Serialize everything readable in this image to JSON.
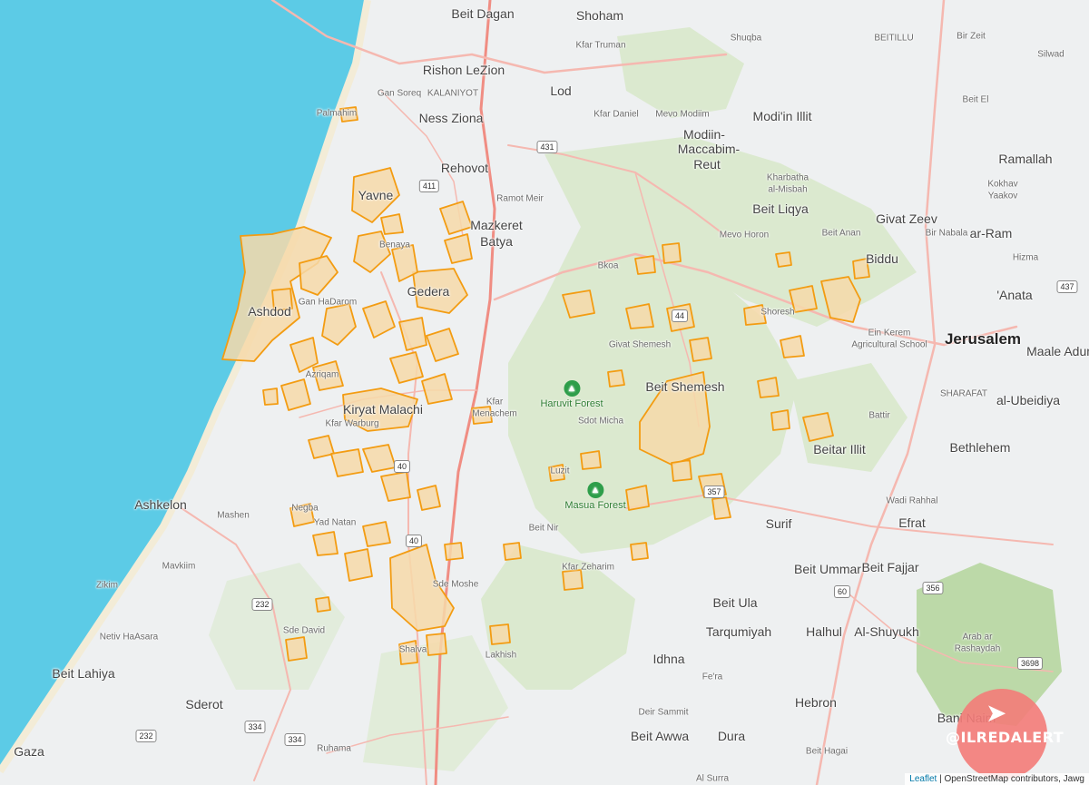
{
  "colors": {
    "sea": "#5ccbe6",
    "land": "#eef0f1",
    "woodland": "#dbe9cf",
    "alert_fill": "#f6d9a9",
    "alert_stroke": "#f39c12",
    "road": "#f5b8b0",
    "highway": "#f08d83"
  },
  "labels": {
    "beit_dagan": "Beit Dagan",
    "shoham": "Shoham",
    "kfar_truman": "Kfar Truman",
    "shuqba": "Shuqba",
    "beitillu": "BEITILLU",
    "bir_zeit": "Bir Zeit",
    "silwad": "Silwad",
    "rishon": "Rishon LeZion",
    "kalaniyot": "KALANIYOT",
    "gan_soreq": "Gan Soreq",
    "lod": "Lod",
    "palmahim": "Palmahim",
    "ness_ziona": "Ness Ziona",
    "kfar_daniel": "Kfar Daniel",
    "mevo_modiim": "Mevo Modiim",
    "modiin_illit": "Modi'in Illit",
    "beit_el": "Beit El",
    "modiin": "Modiin-",
    "maccabim": "Maccabim-",
    "reut": "Reut",
    "ramallah": "Ramallah",
    "rehovot": "Rehovot",
    "kharbatha": "Kharbatha",
    "al_misbah": "al-Misbah",
    "kokhav": "Kokhav",
    "yaakov": "Yaakov",
    "yavne": "Yavne",
    "ramot_meir": "Ramot Meir",
    "mazkeret": "Mazkeret",
    "batya": "Batya",
    "beit_liqya": "Beit Liqya",
    "givat_zeev": "Givat Zeev",
    "beit_anan": "Beit Anan",
    "biddu": "Biddu",
    "mevo_horon": "Mevo Horon",
    "bir_nabala": "Bir Nabala",
    "ar_ram": "ar-Ram",
    "benaya": "Benaya",
    "hizma": "Hizma",
    "bkoa": "Bkoa",
    "gedera": "Gedera",
    "gan_haharom": "Gan HaDarom",
    "ashdod": "Ashdod",
    "anata": "'Anata",
    "shoresh": "Shoresh",
    "ein_kerem": "Ein Kerem",
    "agri_school": "Agricultural School",
    "jerusalem": "Jerusalem",
    "maale_adumim": "Maale Adum",
    "givat_shemesh": "Givat Shemesh",
    "azriqam": "Azriqam",
    "beit_shemesh": "Beit Shemesh",
    "sharafat": "SHARAFAT",
    "kiryat_malachi": "Kiryat Malachi",
    "kfar_menachem_1": "Kfar",
    "kfar_menachem_2": "Menachem",
    "sdot_micha": "Sdot Micha",
    "battir": "Battir",
    "al_ubeidiya": "al-Ubeidiya",
    "kfar_warburg": "Kfar Warburg",
    "beitar_illit": "Beitar Illit",
    "bethlehem": "Bethlehem",
    "luzit": "Luzit",
    "ashkelon": "Ashkelon",
    "wadi_rahhal": "Wadi Rahhal",
    "negba": "Negba",
    "yad_natan": "Yad Natan",
    "efrat": "Efrat",
    "mashen": "Mashen",
    "beit_nir": "Beit Nir",
    "surif": "Surif",
    "mavkiim": "Mavkiim",
    "kfar_zeharim": "Kfar Zeharim",
    "beit_ummar": "Beit Ummar",
    "beit_fajjar": "Beit Fajjar",
    "sde_moshe": "Sde Moshe",
    "zikim": "Zikim",
    "beit_ula": "Beit Ula",
    "sde_david": "Sde David",
    "tarqumiyah": "Tarqumiyah",
    "halhul": "Halhul",
    "al_shuyukh": "Al-Shuyukh",
    "netiv_haasara": "Netiv HaAsara",
    "shalva": "Shalva",
    "lakhish": "Lakhish",
    "arab_ar": "Arab ar",
    "rashaydah": "Rashaydah",
    "idhna": "Idhna",
    "beit_lahiya": "Beit Lahiya",
    "fera": "Fe'ra",
    "sderot": "Sderot",
    "hebron": "Hebron",
    "bani_naim": "Bani Naim",
    "deir_sammit": "Deir Sammit",
    "gaza": "Gaza",
    "beit_awwa": "Beit Awwa",
    "dura": "Dura",
    "ruhama": "Ruhama",
    "beit_hagai": "Beit Hagai",
    "al_surra": "Al Surra"
  },
  "shields": {
    "r431": "431",
    "r411": "411",
    "r44": "44",
    "r437": "437",
    "r40a": "40",
    "r40b": "40",
    "r357": "357",
    "r232a": "232",
    "r60": "60",
    "r356": "356",
    "r3698": "3698",
    "r334a": "334",
    "r334b": "334",
    "r232b": "232"
  },
  "forests": {
    "haruvit": "Haruvit Forest",
    "masua": "Masua Forest",
    "icon": "tree-icon"
  },
  "attribution": {
    "leaflet": "Leaflet",
    "sep": " | ",
    "osm": "OpenStreetMap contributors, Jawg"
  },
  "watermark": {
    "handle": "@ILREDALERT",
    "icon": "rocket-icon"
  }
}
